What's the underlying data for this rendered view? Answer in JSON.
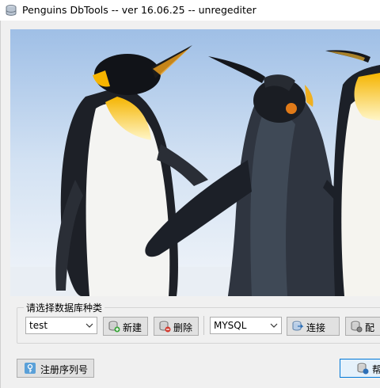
{
  "window": {
    "title": "Penguins DbTools -- ver 16.06.25 -- unregediter"
  },
  "db_group": {
    "label": "请选择数据库种类",
    "config_select": {
      "value": "test"
    },
    "new_label": "新建",
    "delete_label": "删除",
    "db_type_select": {
      "value": "MYSQL"
    },
    "connect_label": "连接",
    "config_label": "配"
  },
  "footer": {
    "register_label": "注册序列号",
    "help_label": "帮"
  },
  "colors": {
    "accent": "#0078d7",
    "sky": "#d9e7f6"
  }
}
